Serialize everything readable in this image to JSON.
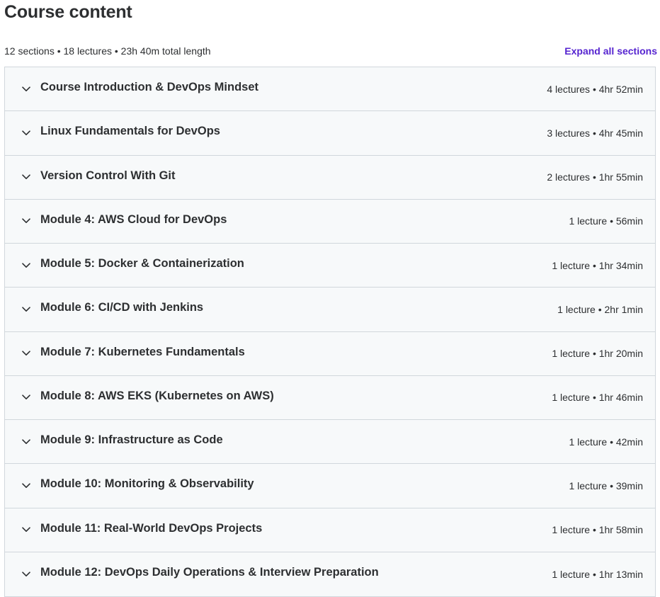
{
  "header": {
    "title": "Course content",
    "summary": "12 sections • 18 lectures • 23h 40m total length",
    "expand_all_label": "Expand all sections"
  },
  "accent_color": "#5624d0",
  "sections": [
    {
      "title": "Course Introduction & DevOps Mindset",
      "meta": "4 lectures • 4hr 52min",
      "icon": "chevron-down-icon"
    },
    {
      "title": "Linux Fundamentals for DevOps",
      "meta": "3 lectures • 4hr 45min",
      "icon": "chevron-down-icon"
    },
    {
      "title": "Version Control With Git",
      "meta": "2 lectures • 1hr 55min",
      "icon": "chevron-down-icon"
    },
    {
      "title": "Module 4: AWS Cloud for DevOps",
      "meta": "1 lecture • 56min",
      "icon": "chevron-down-icon"
    },
    {
      "title": "Module 5: Docker & Containerization",
      "meta": "1 lecture • 1hr 34min",
      "icon": "chevron-down-icon"
    },
    {
      "title": "Module 6: CI/CD with Jenkins",
      "meta": "1 lecture • 2hr 1min",
      "icon": "chevron-down-icon"
    },
    {
      "title": "Module 7: Kubernetes Fundamentals",
      "meta": "1 lecture • 1hr 20min",
      "icon": "chevron-down-icon"
    },
    {
      "title": "Module 8: AWS EKS (Kubernetes on AWS)",
      "meta": "1 lecture • 1hr 46min",
      "icon": "chevron-down-icon"
    },
    {
      "title": "Module 9: Infrastructure as Code",
      "meta": "1 lecture • 42min",
      "icon": "chevron-down-icon"
    },
    {
      "title": "Module 10: Monitoring & Observability",
      "meta": "1 lecture • 39min",
      "icon": "chevron-down-icon"
    },
    {
      "title": "Module 11: Real-World DevOps Projects",
      "meta": "1 lecture • 1hr 58min",
      "icon": "chevron-down-icon"
    },
    {
      "title": "Module 12: DevOps Daily Operations & Interview Preparation",
      "meta": "1 lecture • 1hr 13min",
      "icon": "chevron-down-icon"
    }
  ]
}
